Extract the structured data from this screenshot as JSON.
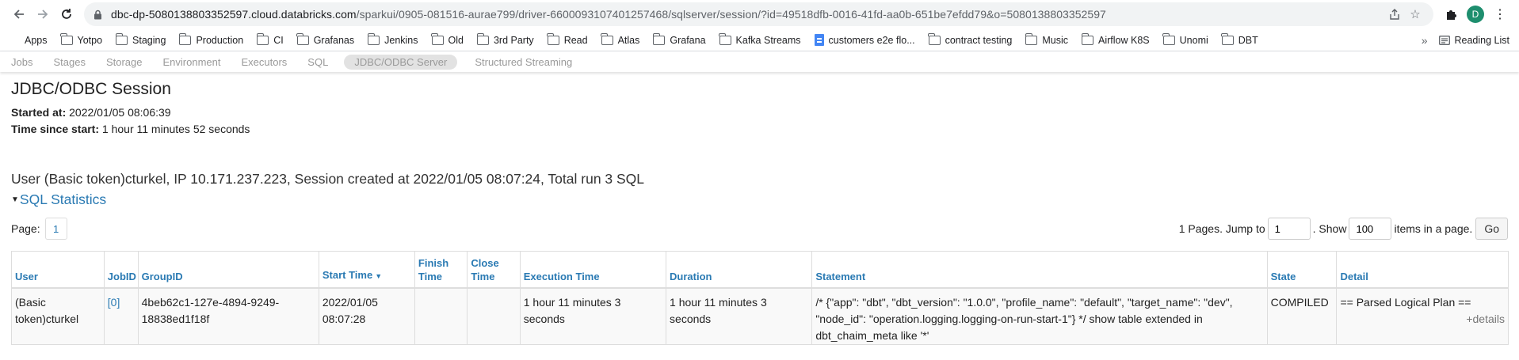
{
  "browser": {
    "url_host": "dbc-dp-5080138803352597.cloud.databricks.com",
    "url_path": "/sparkui/0905-081516-aurae799/driver-6600093107401257468/sqlserver/session/?id=49518dfb-0016-41fd-aa0b-651be7efdd79&o=5080138803352597",
    "avatar_letter": "D"
  },
  "bookmarks": {
    "items": [
      "Apps",
      "Yotpo",
      "Staging",
      "Production",
      "CI",
      "Grafanas",
      "Jenkins",
      "Old",
      "3rd Party",
      "Read",
      "Atlas",
      "Grafana",
      "Kafka Streams",
      "customers e2e flo...",
      "contract testing",
      "Music",
      "Airflow K8S",
      "Unomi",
      "DBT"
    ],
    "more": "»",
    "reading_list": "Reading List"
  },
  "spark_nav": {
    "tabs": [
      "Jobs",
      "Stages",
      "Storage",
      "Environment",
      "Executors",
      "SQL",
      "JDBC/ODBC Server",
      "Structured Streaming"
    ],
    "active_index": 6
  },
  "page": {
    "title": "JDBC/ODBC Session",
    "started_at_label": "Started at:",
    "started_at": "2022/01/05 08:06:39",
    "time_since_label": "Time since start:",
    "time_since": "1 hour 11 minutes 52 seconds",
    "session_line": "User (Basic token)cturkel, IP 10.171.237.223, Session created at 2022/01/05 08:07:24, Total run 3 SQL",
    "sql_stats_link": "SQL Statistics"
  },
  "pager": {
    "page_label": "Page:",
    "current_page": "1",
    "pages_text": "1 Pages. Jump to",
    "jump_value": "1",
    "show_text": ". Show",
    "show_value": "100",
    "items_text": "items in a page.",
    "go_label": "Go"
  },
  "table": {
    "headers": [
      "User",
      "JobID",
      "GroupID",
      "Start Time",
      "Finish Time",
      "Close Time",
      "Execution Time",
      "Duration",
      "Statement",
      "State",
      "Detail"
    ],
    "sorted_column": "Start Time",
    "rows": [
      {
        "user": "(Basic token)cturkel",
        "job_id": "[0]",
        "group_id": "4beb62c1-127e-4894-9249-18838ed1f18f",
        "start_time": "2022/01/05 08:07:28",
        "finish_time": "",
        "close_time": "",
        "execution_time": "1 hour 11 minutes 3 seconds",
        "duration": "1 hour 11 minutes 3 seconds",
        "statement": "/* {\"app\": \"dbt\", \"dbt_version\": \"1.0.0\", \"profile_name\": \"default\", \"target_name\": \"dev\", \"node_id\": \"operation.logging.logging-on-run-start-1\"} */ show table extended in dbt_chaim_meta like '*'",
        "state": "COMPILED",
        "detail": "== Parsed Logical Plan ==",
        "details_link": "+details"
      }
    ]
  }
}
